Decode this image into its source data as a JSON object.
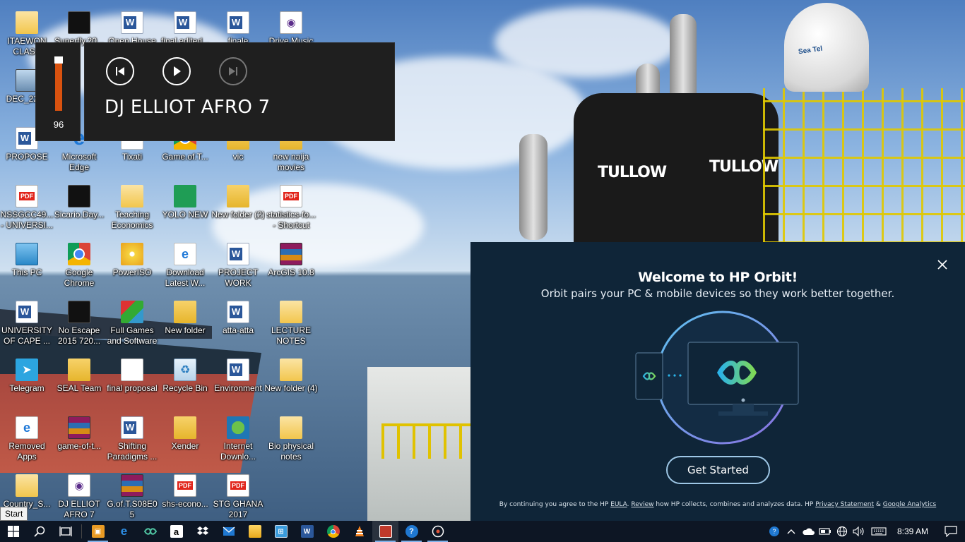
{
  "desktop": {
    "icons": [
      {
        "label": "ITAEWON CLASS",
        "icon": "folder-doc-icon"
      },
      {
        "label": "Superfly.20...",
        "icon": "video-icon"
      },
      {
        "label": "Open House (Ko Wen)",
        "icon": "word-icon"
      },
      {
        "label": "final edited...",
        "icon": "word-icon"
      },
      {
        "label": "finale",
        "icon": "word-icon"
      },
      {
        "label": "Drive Music",
        "icon": "music-icon"
      },
      {
        "label": "DEC_2220",
        "icon": "photo-icon"
      },
      {
        "label": "PROPOSE",
        "icon": "word-icon"
      },
      {
        "label": "Microsoft Edge",
        "icon": "edge-icon"
      },
      {
        "label": "Tixati",
        "icon": "tixati-icon"
      },
      {
        "label": "Game.of.T...",
        "icon": "chrome-file-icon"
      },
      {
        "label": "vic",
        "icon": "folder-icon"
      },
      {
        "label": "new naija movies",
        "icon": "folder-icon"
      },
      {
        "label": "NSSGCC49... - UNIVERSI...",
        "icon": "pdf-icon"
      },
      {
        "label": "Sicario.Day...",
        "icon": "video-icon"
      },
      {
        "label": "Teaching Economics",
        "icon": "folder-doc-icon"
      },
      {
        "label": "YOLO NEW",
        "icon": "yolo-icon"
      },
      {
        "label": "New folder (2)",
        "icon": "folder-icon"
      },
      {
        "label": "statistics-fo... - Shortcut",
        "icon": "pdf-icon"
      },
      {
        "label": "This PC",
        "icon": "this-pc-icon"
      },
      {
        "label": "Google Chrome",
        "icon": "chrome-icon"
      },
      {
        "label": "PowerISO",
        "icon": "poweriso-icon"
      },
      {
        "label": "Download Latest W...",
        "icon": "edge-file-icon"
      },
      {
        "label": "PROJECT WORK",
        "icon": "word-icon"
      },
      {
        "label": "ArcGIS 10.8",
        "icon": "winrar-icon"
      },
      {
        "label": "UNIVERSITY OF CAPE ...",
        "icon": "word-icon"
      },
      {
        "label": "No Escape 2015 720...",
        "icon": "video-icon"
      },
      {
        "label": "Full Games and Software",
        "icon": "games-icon"
      },
      {
        "label": "New folder",
        "icon": "folder-icon"
      },
      {
        "label": "atta-atta",
        "icon": "word-icon"
      },
      {
        "label": "LECTURE NOTES",
        "icon": "folder-doc-icon"
      },
      {
        "label": "Telegram",
        "icon": "telegram-icon"
      },
      {
        "label": "SEAL Team",
        "icon": "folder-icon"
      },
      {
        "label": "final proposal",
        "icon": "blank-doc-icon"
      },
      {
        "label": "Recycle Bin",
        "icon": "recycle-bin-icon"
      },
      {
        "label": "Environment",
        "icon": "word-icon"
      },
      {
        "label": "New folder (4)",
        "icon": "folder-doc-icon"
      },
      {
        "label": "Removed Apps",
        "icon": "edge-file-icon"
      },
      {
        "label": "game-of-t...",
        "icon": "winrar-icon"
      },
      {
        "label": "Shifting Paradigms ...",
        "icon": "word-icon"
      },
      {
        "label": "Xender",
        "icon": "folder-icon"
      },
      {
        "label": "Internet Downlo...",
        "icon": "idm-icon"
      },
      {
        "label": "Bio physical notes",
        "icon": "folder-doc-icon"
      },
      {
        "label": "Country_S...",
        "icon": "folder-check-icon"
      },
      {
        "label": "DJ ELLIOT AFRO 7",
        "icon": "music-icon"
      },
      {
        "label": "G.of.T.S08E05",
        "icon": "winrar-icon"
      },
      {
        "label": "shs-econo...",
        "icon": "pdf-icon"
      },
      {
        "label": "STG GHANA 2017",
        "icon": "pdf-icon"
      }
    ]
  },
  "volume": {
    "level": 96,
    "label": "96"
  },
  "media": {
    "title": "DJ ELLIOT AFRO 7"
  },
  "orbit": {
    "title": "Welcome to HP Orbit!",
    "subtitle": "Orbit pairs your PC & mobile devices so they work better together.",
    "cta": "Get Started",
    "legal_prefix": "By continuing you agree to the HP ",
    "legal_eula": "EULA",
    "legal_mid": ". ",
    "legal_review": "Review",
    "legal_mid2": " how HP collects, combines and analyzes data. HP ",
    "legal_privacy": "Privacy Statement",
    "legal_amp": " & ",
    "legal_ga": "Google Analytics",
    "colors": {
      "background": "#0f2538",
      "accent": "#9ec7e6"
    }
  },
  "tooltip": {
    "start": "Start"
  },
  "wallpaper": {
    "brand_text": "TULLOW",
    "dome_text": "Sea Tel"
  },
  "taskbar": {
    "clock": "8:39 AM",
    "apps": [
      "store-icon",
      "edge-icon",
      "hp-orbit-icon",
      "amazon-icon",
      "dropbox-icon",
      "mail-icon",
      "file-explorer-icon",
      "network-icon",
      "word-icon",
      "chrome-icon",
      "vlc-icon",
      "photo-app-icon",
      "help-icon",
      "groove-music-icon"
    ],
    "amazon_glyph": "a",
    "word_glyph": "W",
    "tray_icons": [
      "help-tray-icon",
      "chevron-up-icon",
      "onedrive-icon",
      "battery-icon",
      "network-tray-icon",
      "volume-tray-icon",
      "keyboard-icon"
    ]
  }
}
